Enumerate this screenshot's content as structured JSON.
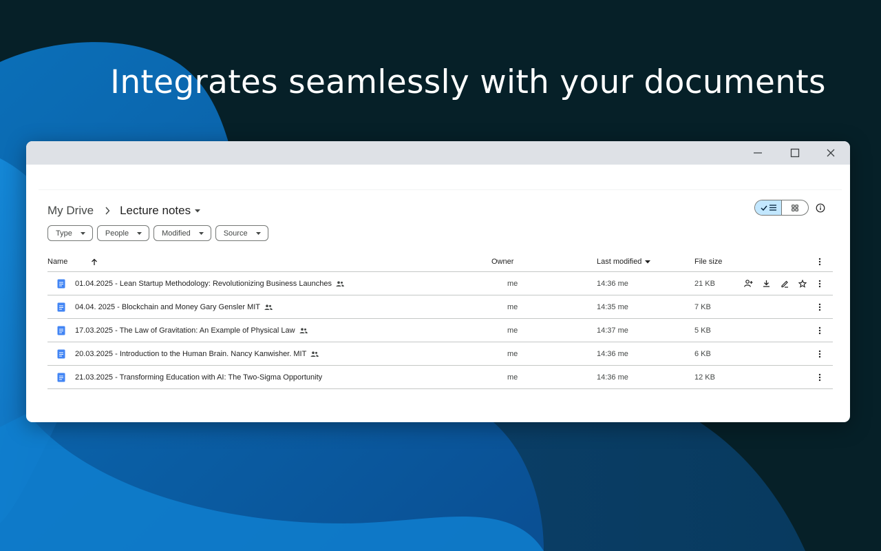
{
  "headline": "Integrates seamlessly with your documents",
  "breadcrumb": {
    "root": "My Drive",
    "current": "Lecture notes"
  },
  "filters": [
    "Type",
    "People",
    "Modified",
    "Source"
  ],
  "columns": {
    "name": "Name",
    "owner": "Owner",
    "modified": "Last modified",
    "size": "File size"
  },
  "files": [
    {
      "title": "01.04.2025 - Lean Startup Methodology: Revolutionizing Business Launches",
      "owner": "me",
      "modified": "14:36 me",
      "size": "21 KB"
    },
    {
      "title": "04.04. 2025 - Blockchain and Money Gary Gensler MIT",
      "owner": "me",
      "modified": "14:35 me",
      "size": "7 KB"
    },
    {
      "title": "17.03.2025 - The Law of Gravitation: An Example of Physical Law",
      "owner": "me",
      "modified": "14:37 me",
      "size": "5 KB"
    },
    {
      "title": "20.03.2025 - Introduction to the Human Brain. Nancy Kanwisher. MIT",
      "owner": "me",
      "modified": "14:36 me",
      "size": "6 KB"
    },
    {
      "title": "21.03.2025 - Transforming Education with AI: The Two-Sigma Opportunity",
      "owner": "me",
      "modified": "14:36 me",
      "size": "12 KB"
    }
  ],
  "colors": {
    "background": "#062028",
    "accent_blue": "#1a73e8",
    "doc_icon": "#4285f4",
    "toggle_selected": "#c2e7ff"
  },
  "icons": {
    "window": [
      "minimize-icon",
      "maximize-icon",
      "close-icon"
    ],
    "row_actions": [
      "share-icon",
      "download-icon",
      "rename-icon",
      "star-icon"
    ],
    "misc": [
      "doc-icon",
      "shared-people-icon",
      "more-vert-icon",
      "info-icon",
      "list-view-icon",
      "grid-view-icon",
      "check-icon",
      "sort-up-icon",
      "sort-down-icon"
    ]
  }
}
